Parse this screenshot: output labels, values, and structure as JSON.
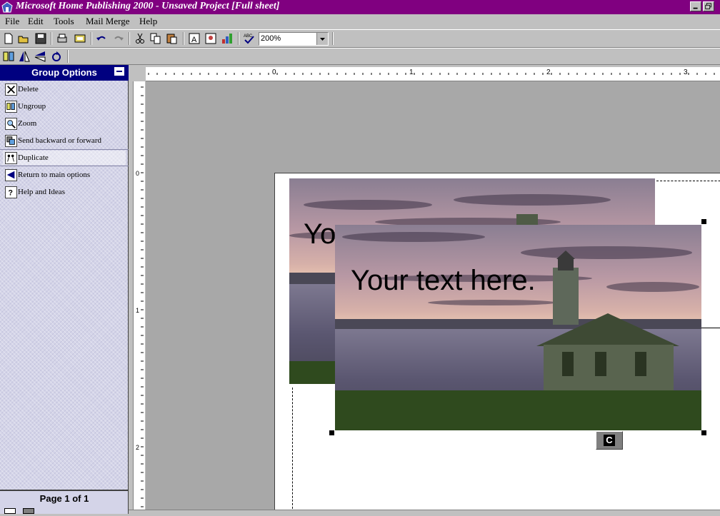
{
  "window": {
    "title": "Microsoft Home Publishing 2000 - Unsaved Project [Full sheet]",
    "buttons": [
      "minimize-icon",
      "restore-icon"
    ]
  },
  "menu": {
    "items": [
      "File",
      "Edit",
      "Tools",
      "Mail Merge",
      "Help"
    ],
    "mnemonics": [
      "F",
      "E",
      "T",
      "M",
      "H"
    ]
  },
  "toolbar": {
    "zoom_value": "200%"
  },
  "panel": {
    "title": "Group Options",
    "options": [
      {
        "label": "Delete",
        "icon": "delete-icon"
      },
      {
        "label": "Ungroup",
        "icon": "ungroup-icon"
      },
      {
        "label": "Zoom",
        "icon": "zoom-icon"
      },
      {
        "label": "Send backward or forward",
        "icon": "arrange-icon"
      },
      {
        "label": "Duplicate",
        "icon": "duplicate-icon"
      },
      {
        "label": "Return to main options",
        "icon": "return-icon"
      },
      {
        "label": "Help and Ideas",
        "icon": "help-icon"
      }
    ],
    "page_indicator": "Page 1 of 1"
  },
  "ruler": {
    "h_labels": [
      "0",
      "1",
      "2",
      "3"
    ],
    "v_labels": [
      "0",
      "1",
      "2"
    ]
  },
  "canvas": {
    "back_text": "Yo",
    "front_text": "Your text here.",
    "connect_label": "C"
  },
  "colors": {
    "titlebar": "#800080",
    "panel_header": "#000080",
    "workspace": "#a8a8a8"
  }
}
